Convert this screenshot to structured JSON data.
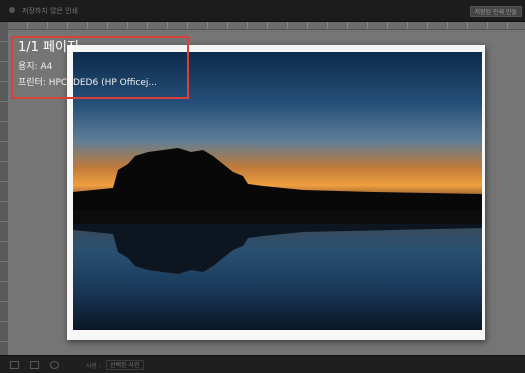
{
  "window": {
    "title": "저장하지 않은 인쇄"
  },
  "toolbar": {
    "saved_print_label": "저장된 인쇄 만들"
  },
  "preview": {
    "page_info": "1/1 페이지",
    "paper_info": "용지: A4",
    "printer_info": "프린터: HPC7DED6 (HP Officej..."
  },
  "bottombar": {
    "use_label": "사용 :",
    "use_value": "선택된 사진",
    "page_counter": ""
  },
  "colors": {
    "highlight": "#d9403a",
    "canvas": "#757575",
    "chrome": "#1c1c1c"
  },
  "icons": [
    "app-icon",
    "single-image-icon",
    "grid-icon",
    "rotate-icon"
  ]
}
